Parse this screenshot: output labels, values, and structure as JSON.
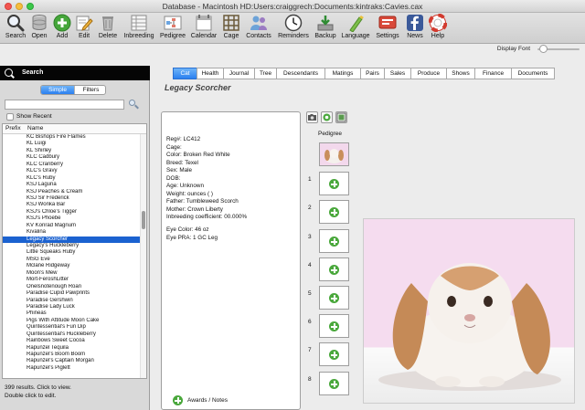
{
  "window": {
    "title": "Database - Macintosh HD:Users:craiggrech:Documents:kintraks:Cavies.cax"
  },
  "toolbar": {
    "items": [
      {
        "label": "Search",
        "icon": "search-icon"
      },
      {
        "label": "Open",
        "icon": "database-icon"
      },
      {
        "label": "Add",
        "icon": "add-icon"
      },
      {
        "label": "Edit",
        "icon": "edit-icon"
      },
      {
        "label": "Delete",
        "icon": "trash-icon"
      },
      {
        "label": "Inbreeding",
        "icon": "inbreeding-icon"
      },
      {
        "label": "Pedigree",
        "icon": "pedigree-icon"
      },
      {
        "label": "Calendar",
        "icon": "calendar-icon"
      },
      {
        "label": "Cage",
        "icon": "cage-icon"
      },
      {
        "label": "Contacts",
        "icon": "contacts-icon"
      },
      {
        "label": "Reminders",
        "icon": "clock-icon"
      },
      {
        "label": "Backup",
        "icon": "backup-icon"
      },
      {
        "label": "Language",
        "icon": "language-icon"
      },
      {
        "label": "Settings",
        "icon": "settings-icon"
      },
      {
        "label": "News",
        "icon": "facebook-icon"
      },
      {
        "label": "Help",
        "icon": "help-icon"
      }
    ],
    "display_font_label": "Display Font"
  },
  "sidebar": {
    "search_title": "Search",
    "segments": [
      "Simple",
      "Filters"
    ],
    "search_value": "",
    "show_recent_label": "Show Recent",
    "columns": [
      "Prefix",
      "Name"
    ],
    "rows": [
      "KC Bishops Fire Flames",
      "KL Luigi",
      "KL Shirley",
      "KLC Cadbury",
      "KLC Cranberry",
      "KLC's Gravy",
      "KLC's Ruby",
      "KSJ Laguna",
      "KSJ Peaches & Cream",
      "KSJ Sir Frederick",
      "KSJ Wonka Bar",
      "KSJ's Chloe's Tigger",
      "KSJ's Phoebe",
      "KV Konrad Magnum",
      "Kivalina",
      "Legacy Scorcher",
      "Legacy's Huckleberry",
      "Little Squeaks Ruby",
      "MSG Eve",
      "Mclane Ridgeway",
      "Moon's Mew",
      "Mort-FeroshLitter",
      "Onelsnotenough Roan",
      "Paradise Cupid Pawprints",
      "Paradise Gershwin",
      "Paradise Lady Luck",
      "Phineas",
      "Pigs With Attitude Moon Cake",
      "Quintessential's Fun Dip",
      "Quintessential's Huckleberry",
      "Rainbows Sweet Cocoa",
      "Rapunzel Tequila",
      "Rapunzel's Boom Boom",
      "Rapunzel's Captain Morgan",
      "Rapunzel's Piglett"
    ],
    "selected_index": 15,
    "footer_line1": "399 results. Click to view.",
    "footer_line2": "Double click to edit."
  },
  "main": {
    "tabs": [
      "Cat",
      "Health",
      "Journal",
      "Tree",
      "Descendants",
      "Matings",
      "Pairs",
      "Sales",
      "Produce",
      "Shows",
      "Finance",
      "Documents"
    ],
    "active_tab": 0,
    "record_title": "Legacy Scorcher",
    "details": [
      "Reg#: LC412",
      "Cage:",
      "Color: Broken Red  White",
      "Breed: Texel",
      "Sex: Male",
      "DOB:",
      "Age: Unknown",
      "Weight:  ounces ( )",
      "Father: Tumbleweed Scorch",
      "Mother: Crown Liberty",
      "Inbreeding coefficient: 00.000%",
      "",
      "Eye Color: 46 oz",
      "Eye PRA: 1 GC Leg"
    ],
    "awards_label": "Awards / Notes",
    "pedigree_label": "Pedigree",
    "pedigree_slots": [
      "1",
      "2",
      "3",
      "4",
      "5",
      "6",
      "7",
      "8"
    ]
  }
}
